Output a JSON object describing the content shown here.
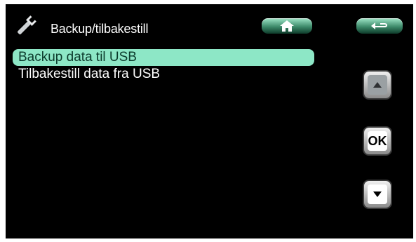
{
  "header": {
    "title": "Backup/tilbakestill",
    "icon": "wrench-icon"
  },
  "nav": {
    "home_icon": "home-icon",
    "back_icon": "back-arrow-icon",
    "up_icon": "arrow-up-icon",
    "down_icon": "arrow-down-icon",
    "ok_label": "OK"
  },
  "menu": {
    "items": [
      {
        "label": "Backup data til USB",
        "selected": true
      },
      {
        "label": "Tilbakestill data fra USB",
        "selected": false
      }
    ]
  },
  "colors": {
    "background": "#000000",
    "selection": "#8de7c6",
    "button_green": "#3d8a6a"
  }
}
